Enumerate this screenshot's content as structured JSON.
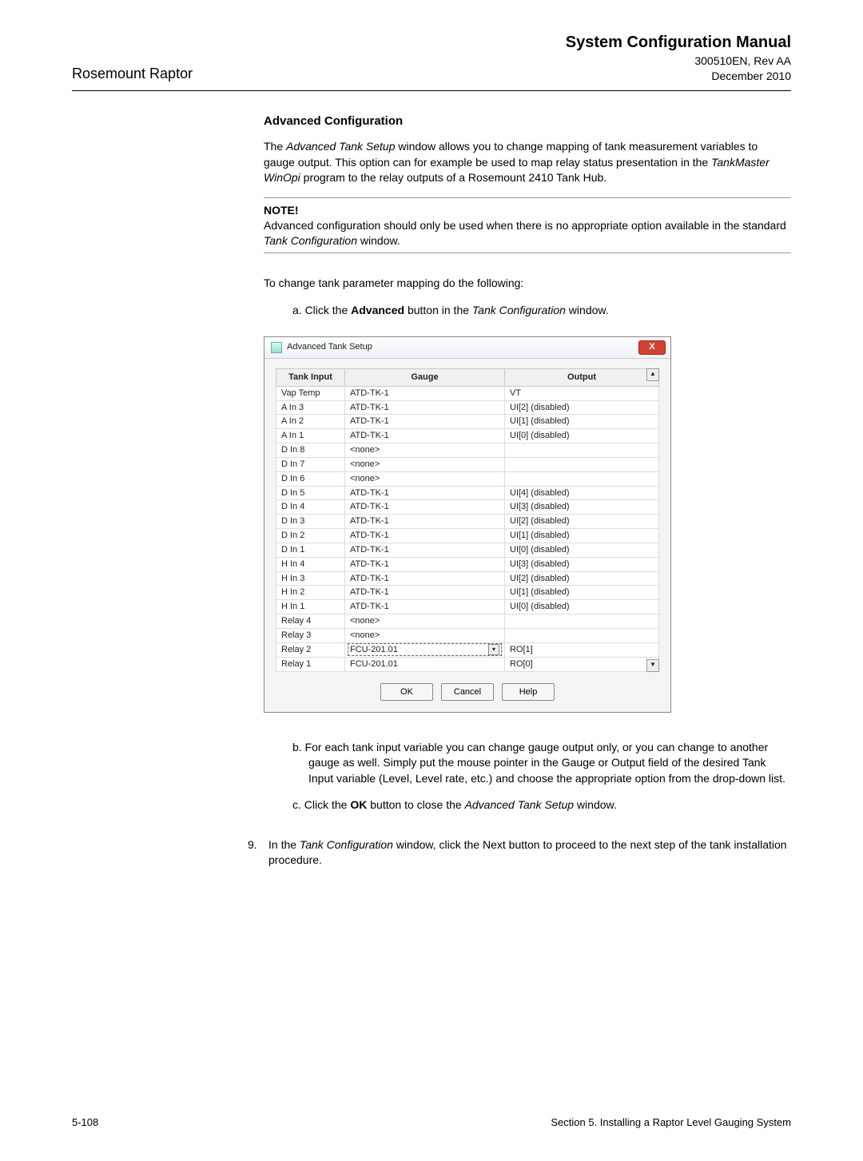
{
  "header": {
    "left": "Rosemount Raptor",
    "title": "System Configuration Manual",
    "doc": "300510EN, Rev AA",
    "date": "December 2010"
  },
  "section_title": "Advanced Configuration",
  "para1_pre": "The ",
  "para1_em1": "Advanced Tank Setup",
  "para1_mid": " window allows you to change mapping of tank measurement variables to gauge output. This option can for example be used to map relay status presentation in the ",
  "para1_em2": "TankMaster WinOpi",
  "para1_post": " program to the relay outputs of a Rosemount 2410 Tank Hub.",
  "note": {
    "title": "NOTE!",
    "text_pre": "Advanced configuration should only be used when there is no appropriate option available in the standard ",
    "text_em": "Tank Configuration",
    "text_post": " window."
  },
  "intro2": "To change tank parameter mapping do the following:",
  "step_a_pre": "a.  Click the ",
  "step_a_bold": "Advanced",
  "step_a_mid": " button in the ",
  "step_a_em": "Tank Configuration",
  "step_a_post": " window.",
  "dialog": {
    "title": "Advanced Tank Setup",
    "close": "X",
    "cols": {
      "c1": "Tank Input",
      "c2": "Gauge",
      "c3": "Output"
    },
    "rows": [
      {
        "c1": "Vap Temp",
        "c2": "ATD-TK-1",
        "c3": "VT"
      },
      {
        "c1": "A In 3",
        "c2": "ATD-TK-1",
        "c3": "UI[2] (disabled)"
      },
      {
        "c1": "A In 2",
        "c2": "ATD-TK-1",
        "c3": "UI[1] (disabled)"
      },
      {
        "c1": "A In 1",
        "c2": "ATD-TK-1",
        "c3": "UI[0] (disabled)"
      },
      {
        "c1": "D In 8",
        "c2": "<none>",
        "c3": ""
      },
      {
        "c1": "D In 7",
        "c2": "<none>",
        "c3": ""
      },
      {
        "c1": "D In 6",
        "c2": "<none>",
        "c3": ""
      },
      {
        "c1": "D In 5",
        "c2": "ATD-TK-1",
        "c3": "UI[4] (disabled)"
      },
      {
        "c1": "D In 4",
        "c2": "ATD-TK-1",
        "c3": "UI[3] (disabled)"
      },
      {
        "c1": "D In 3",
        "c2": "ATD-TK-1",
        "c3": "UI[2] (disabled)"
      },
      {
        "c1": "D In 2",
        "c2": "ATD-TK-1",
        "c3": "UI[1] (disabled)"
      },
      {
        "c1": "D In 1",
        "c2": "ATD-TK-1",
        "c3": "UI[0] (disabled)"
      },
      {
        "c1": "H In 4",
        "c2": "ATD-TK-1",
        "c3": "UI[3] (disabled)"
      },
      {
        "c1": "H In 3",
        "c2": "ATD-TK-1",
        "c3": "UI[2] (disabled)"
      },
      {
        "c1": "H In 2",
        "c2": "ATD-TK-1",
        "c3": "UI[1] (disabled)"
      },
      {
        "c1": "H In 1",
        "c2": "ATD-TK-1",
        "c3": "UI[0] (disabled)"
      },
      {
        "c1": "Relay 4",
        "c2": "<none>",
        "c3": ""
      },
      {
        "c1": "Relay 3",
        "c2": "<none>",
        "c3": ""
      },
      {
        "c1": "Relay 2",
        "c2": "FCU-201.01",
        "c3": "RO[1]",
        "dd": true
      },
      {
        "c1": "Relay 1",
        "c2": "FCU-201.01",
        "c3": "RO[0]"
      }
    ],
    "buttons": {
      "ok": "OK",
      "cancel": "Cancel",
      "help": "Help"
    },
    "scroll_up": "▲",
    "scroll_down": "▼",
    "dd_icon": "▾"
  },
  "step_b": "b.  For each tank input variable you can change gauge output only, or you can change to another gauge as well. Simply put the mouse pointer in the Gauge or Output field of the desired Tank Input variable (Level, Level rate, etc.) and choose the appropriate option from the drop-down list.",
  "step_c_pre": "c.  Click the ",
  "step_c_bold": "OK",
  "step_c_mid": " button to close the ",
  "step_c_em": "Advanced Tank Setup",
  "step_c_post": " window.",
  "step9_num": "9.",
  "step9_pre": "In the ",
  "step9_em": "Tank Configuration",
  "step9_post": " window, click the Next button to proceed to the next step of the tank installation procedure.",
  "footer": {
    "left": "5-108",
    "right": "Section 5. Installing a Raptor Level Gauging System"
  }
}
